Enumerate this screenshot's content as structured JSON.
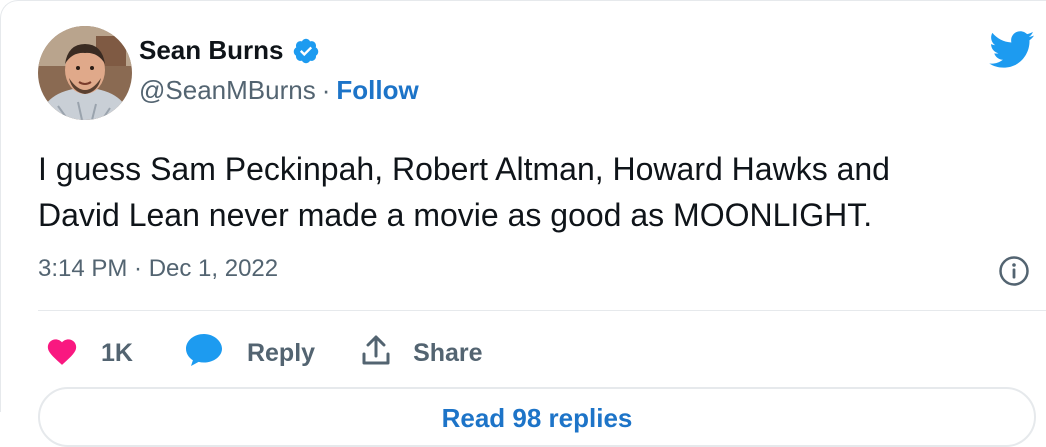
{
  "author": {
    "name": "Sean Burns",
    "handle": "@SeanMBurns",
    "separator": "·",
    "follow_label": "Follow",
    "verified_icon": "verified-badge-icon",
    "avatar_icon": "avatar-photo"
  },
  "tweet": {
    "text": "I guess Sam Peckinpah, Robert Altman, Howard Hawks and\nDavid Lean never made a movie as good as MOONLIGHT.",
    "timestamp": "3:14 PM · Dec 1, 2022"
  },
  "actions": {
    "like_count": "1K",
    "reply_label": "Reply",
    "share_label": "Share"
  },
  "footer": {
    "read_replies_label": "Read 98 replies"
  },
  "colors": {
    "accent": "#1d74c8",
    "twitter_blue": "#1d9bf0",
    "like_pink": "#f91880",
    "text_primary": "#0f1419",
    "text_secondary": "#536471",
    "border": "#e6e9ec"
  }
}
